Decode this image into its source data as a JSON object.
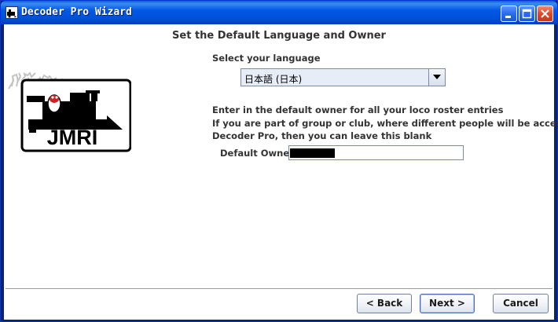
{
  "window": {
    "title": "Decoder Pro Wizard"
  },
  "heading": "Set the Default Language and Owner",
  "language": {
    "label": "Select your language",
    "selected": "日本語 (日本)"
  },
  "owner": {
    "instructions": [
      "Enter in the default owner for all your loco roster entries",
      "If you are part of group or club, where different people will be accessing",
      "Decoder Pro, then you can leave this blank"
    ],
    "label": "Default Owner",
    "value": ""
  },
  "logo": {
    "text": "JMRI"
  },
  "buttons": {
    "back": "< Back",
    "next": "Next >",
    "cancel": "Cancel"
  },
  "colors": {
    "title_bar": "#0058e6",
    "close_button": "#e0482a",
    "client_bg": "#ffffff"
  },
  "icons": {
    "app": "jmri-train-icon",
    "minimize": "minimize-icon",
    "maximize": "maximize-icon",
    "close": "close-icon",
    "dropdown": "chevron-down-icon"
  }
}
